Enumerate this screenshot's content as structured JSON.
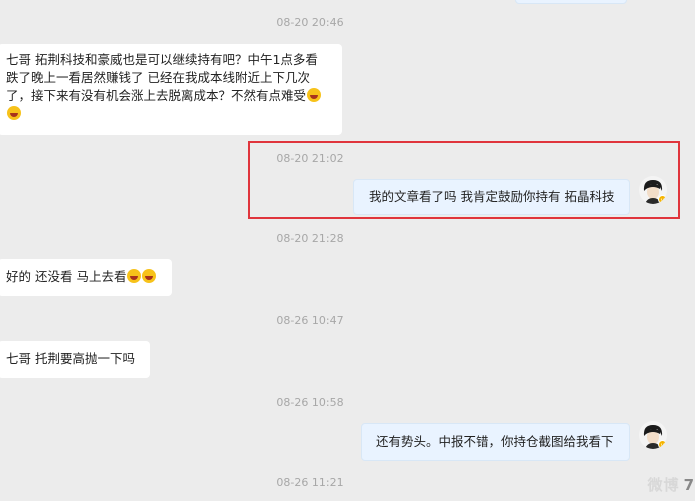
{
  "messages": {
    "ts1": "08-20 20:46",
    "msg1": "七哥 拓荆科技和豪威也是可以继续持有吧？中午1点多看跌了晚上一看居然赚钱了 已经在我成本线附近上下几次了，接下来有没有机会涨上去脱离成本？不然有点难受",
    "ts2": "08-20 21:02",
    "msg2": "我的文章看了吗 我肯定鼓励你持有 拓晶科技",
    "ts3": "08-20 21:28",
    "msg3": "好的 还没看 马上去看",
    "ts4": "08-26 10:47",
    "msg4": "七哥 托荆要高抛一下吗",
    "ts5": "08-26 10:58",
    "msg5": "还有势头。中报不错，你持仓截图给我看下",
    "ts6": "08-26 11:21"
  },
  "emoji": "laughing-crying-face",
  "watermark": {
    "text": "微博",
    "number": "7"
  },
  "colors": {
    "highlight_border": "#e0353c",
    "outgoing_bubble": "#e9f3ff",
    "incoming_bubble": "#ffffff",
    "background": "#ececec"
  }
}
